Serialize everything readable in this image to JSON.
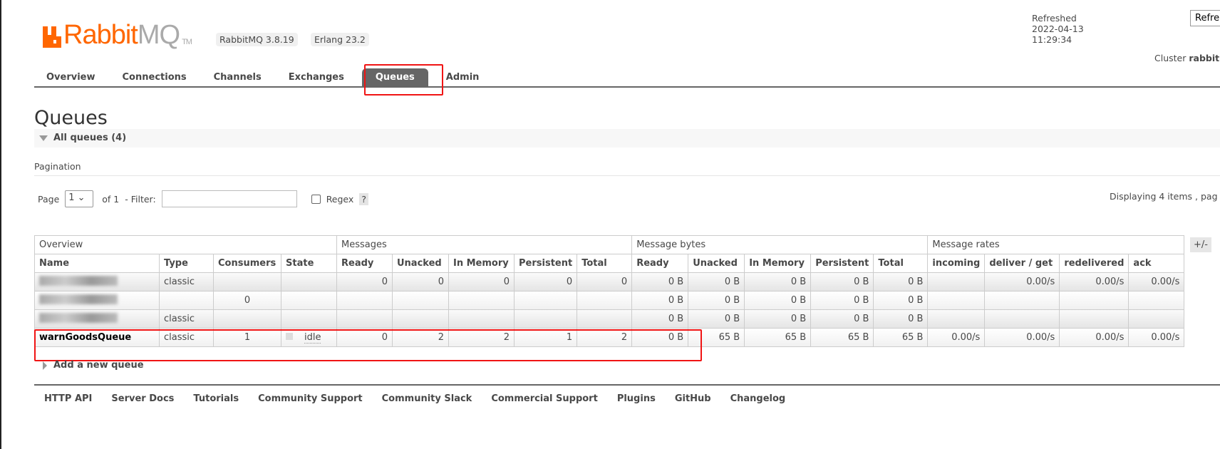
{
  "header": {
    "logo_text": "RabbitMQ",
    "logo_rabbit": "Rabbit",
    "logo_mq": "MQ",
    "logo_tm": "TM",
    "version": "RabbitMQ 3.8.19",
    "erlang": "Erlang 23.2",
    "refreshed": "Refreshed 2022-04-13 11:29:34",
    "refresh_button": "Refre",
    "cluster_label": "Cluster",
    "cluster_name": "rabbit"
  },
  "nav": [
    {
      "label": "Overview"
    },
    {
      "label": "Connections"
    },
    {
      "label": "Channels"
    },
    {
      "label": "Exchanges"
    },
    {
      "label": "Queues",
      "active": true
    },
    {
      "label": "Admin"
    }
  ],
  "page_title": "Queues",
  "section_title": "All queues (4)",
  "pagination": {
    "heading": "Pagination",
    "page_label": "Page",
    "page_value": "1",
    "of_label": "of 1",
    "filter_label": "- Filter:",
    "filter_value": "",
    "regex_label": "Regex",
    "help": "?",
    "displaying": "Displaying 4 items , pag"
  },
  "table": {
    "groups": [
      "Overview",
      "Messages",
      "Message bytes",
      "Message rates"
    ],
    "columns": [
      "Name",
      "Type",
      "Consumers",
      "State",
      "Ready",
      "Unacked",
      "In Memory",
      "Persistent",
      "Total",
      "Ready",
      "Unacked",
      "In Memory",
      "Persistent",
      "Total",
      "incoming",
      "deliver / get",
      "redelivered",
      "ack"
    ],
    "toggle": "+/-",
    "rows": [
      [
        "",
        "classic",
        "",
        "",
        "0",
        "0",
        "0",
        "0",
        "0",
        "0 B",
        "0 B",
        "0 B",
        "0 B",
        "0 B",
        "",
        "0.00/s",
        "0.00/s",
        "0.00/s"
      ],
      [
        "",
        "",
        "0",
        "",
        "",
        "",
        "",
        "",
        "",
        "0 B",
        "0 B",
        "0 B",
        "0 B",
        "0 B",
        "",
        "",
        "",
        ""
      ],
      [
        "",
        "classic",
        "",
        "",
        "",
        "",
        "",
        "",
        "",
        "0 B",
        "0 B",
        "0 B",
        "0 B",
        "0 B",
        "",
        "",
        "",
        ""
      ],
      [
        "warnGoodsQueue",
        "classic",
        "1",
        "idle",
        "0",
        "2",
        "2",
        "1",
        "2",
        "0 B",
        "65 B",
        "65 B",
        "65 B",
        "65 B",
        "0.00/s",
        "0.00/s",
        "0.00/s",
        "0.00/s"
      ]
    ]
  },
  "add_queue": "Add a new queue",
  "footer": [
    "HTTP API",
    "Server Docs",
    "Tutorials",
    "Community Support",
    "Community Slack",
    "Commercial Support",
    "Plugins",
    "GitHub",
    "Changelog"
  ],
  "colors": {
    "brand": "#ff6600",
    "highlight": "#f01414",
    "active_tab": "#666666"
  }
}
